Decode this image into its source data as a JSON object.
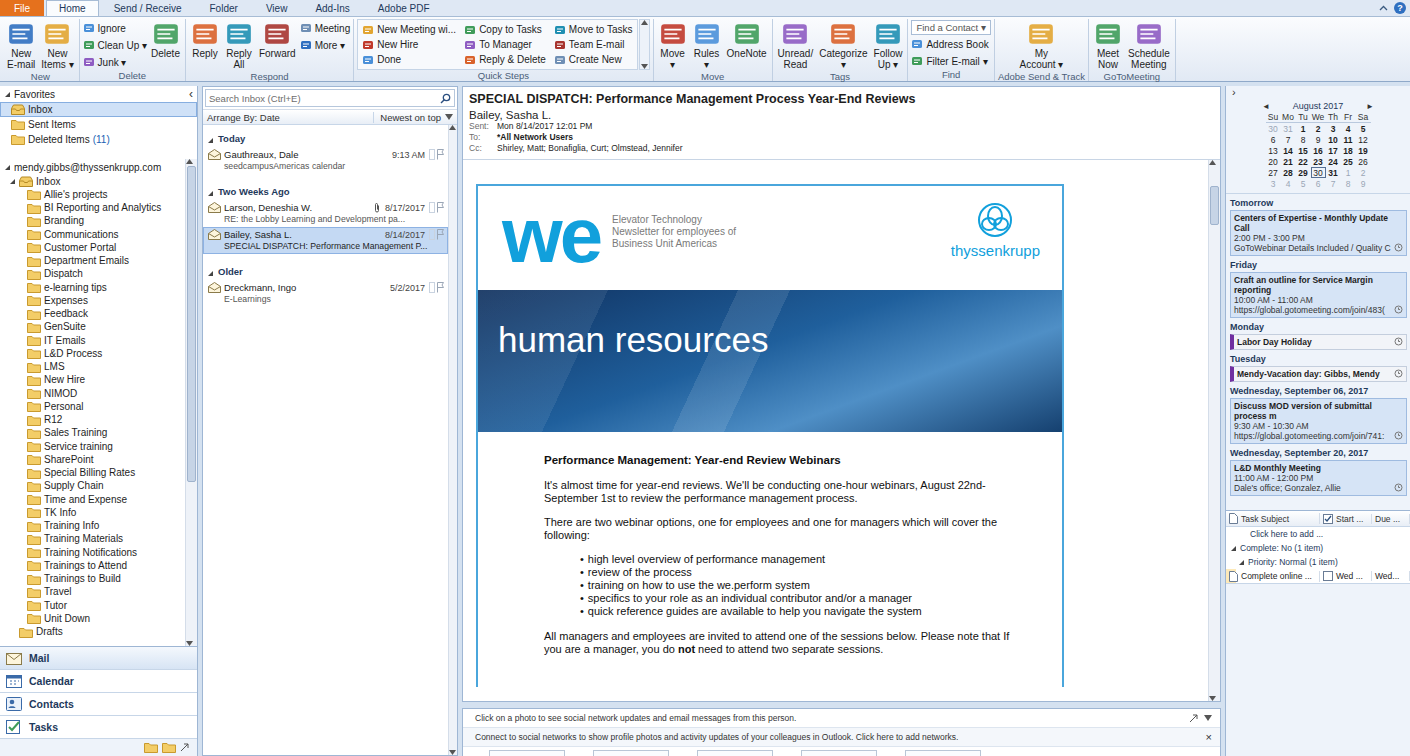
{
  "window": {
    "help": "?"
  },
  "ribbon_tabs": [
    {
      "label": "File",
      "kind": "backstage",
      "selected": false
    },
    {
      "label": "Home",
      "kind": "tab",
      "selected": true
    },
    {
      "label": "Send / Receive",
      "kind": "tab",
      "selected": false
    },
    {
      "label": "Folder",
      "kind": "tab",
      "selected": false
    },
    {
      "label": "View",
      "kind": "tab",
      "selected": false
    },
    {
      "label": "Add-Ins",
      "kind": "tab",
      "selected": false
    },
    {
      "label": "Adobe PDF",
      "kind": "tab",
      "selected": false
    }
  ],
  "ribbon_groups": [
    {
      "label": "New",
      "items": [
        {
          "kind": "large",
          "lines": [
            "New",
            "E-mail"
          ]
        },
        {
          "kind": "large",
          "lines": [
            "New",
            "Items ▾"
          ]
        }
      ]
    },
    {
      "label": "Delete",
      "items": [
        {
          "kind": "stack",
          "entries": [
            "Ignore",
            "Clean Up ▾",
            "Junk ▾"
          ]
        },
        {
          "kind": "large",
          "lines": [
            "Delete"
          ]
        }
      ]
    },
    {
      "label": "Respond",
      "items": [
        {
          "kind": "large",
          "lines": [
            "Reply"
          ]
        },
        {
          "kind": "large",
          "lines": [
            "Reply",
            "All"
          ]
        },
        {
          "kind": "large",
          "lines": [
            "Forward"
          ]
        },
        {
          "kind": "stack",
          "entries": [
            "Meeting",
            "More ▾"
          ]
        }
      ]
    },
    {
      "label": "Quick Steps",
      "items": [
        {
          "kind": "quick",
          "entries": [
            "New Meeting wi...",
            "New Hire",
            "Done",
            "Copy to Tasks",
            "To Manager",
            "Reply & Delete",
            "Move to Tasks",
            "Team E-mail",
            "Create New"
          ]
        }
      ]
    },
    {
      "label": "Move",
      "items": [
        {
          "kind": "large",
          "lines": [
            "Move",
            "▾"
          ]
        },
        {
          "kind": "large",
          "lines": [
            "Rules",
            "▾"
          ]
        },
        {
          "kind": "large",
          "lines": [
            "OneNote"
          ]
        }
      ]
    },
    {
      "label": "Tags",
      "items": [
        {
          "kind": "large",
          "lines": [
            "Unread/",
            "Read"
          ]
        },
        {
          "kind": "large",
          "lines": [
            "Categorize",
            "▾"
          ]
        },
        {
          "kind": "large",
          "lines": [
            "Follow",
            "Up ▾"
          ]
        }
      ]
    },
    {
      "label": "Find",
      "items": [
        {
          "kind": "find",
          "field": "Find a Contact ▾",
          "entries": [
            "Address Book",
            "Filter E-mail ▾"
          ]
        }
      ]
    },
    {
      "label": "Adobe Send & Track",
      "items": [
        {
          "kind": "large",
          "lines": [
            "My",
            "Account ▾"
          ]
        }
      ]
    },
    {
      "label": "GoToMeeting",
      "items": [
        {
          "kind": "large",
          "lines": [
            "Meet",
            "Now"
          ]
        },
        {
          "kind": "large",
          "lines": [
            "Schedule",
            "Meeting"
          ]
        }
      ]
    }
  ],
  "nav": {
    "collapse": "‹",
    "favorites": {
      "label": "Favorites",
      "expanded": true,
      "items": [
        {
          "name": "Inbox",
          "count": "",
          "selected": true
        },
        {
          "name": "Sent Items",
          "count": "",
          "selected": false
        },
        {
          "name": "Deleted Items",
          "count": "(11)",
          "selected": false
        }
      ]
    },
    "account": {
      "label": "mendy.gibbs@thyssenkrupp.com",
      "expanded": true,
      "inbox": {
        "name": "Inbox",
        "expanded": true,
        "selected": false
      },
      "folders": [
        {
          "name": "Allie's projects",
          "selected": false
        },
        {
          "name": "BI Reporting and Analytics",
          "selected": false
        },
        {
          "name": "Branding",
          "selected": false
        },
        {
          "name": "Communications",
          "selected": false
        },
        {
          "name": "Customer Portal",
          "selected": false
        },
        {
          "name": "Department Emails",
          "selected": false
        },
        {
          "name": "Dispatch",
          "selected": false
        },
        {
          "name": "e-learning tips",
          "selected": false
        },
        {
          "name": "Expenses",
          "selected": false
        },
        {
          "name": "Feedback",
          "selected": false
        },
        {
          "name": "GenSuite",
          "selected": false
        },
        {
          "name": "IT Emails",
          "selected": false
        },
        {
          "name": "L&D Process",
          "selected": false
        },
        {
          "name": "LMS",
          "selected": false
        },
        {
          "name": "New Hire",
          "selected": false
        },
        {
          "name": "NIMOD",
          "selected": false
        },
        {
          "name": "Personal",
          "selected": false
        },
        {
          "name": "R12",
          "selected": false
        },
        {
          "name": "Sales Training",
          "selected": false
        },
        {
          "name": "Service training",
          "selected": false
        },
        {
          "name": "SharePoint",
          "selected": false
        },
        {
          "name": "Special Billing Rates",
          "selected": false
        },
        {
          "name": "Supply Chain",
          "selected": false
        },
        {
          "name": "Time and Expense",
          "selected": false
        },
        {
          "name": "TK Info",
          "selected": false
        },
        {
          "name": "Training Info",
          "selected": false
        },
        {
          "name": "Training Materials",
          "selected": false
        },
        {
          "name": "Training Notifications",
          "selected": false
        },
        {
          "name": "Trainings to Attend",
          "selected": false
        },
        {
          "name": "Trainings to Build",
          "selected": false
        },
        {
          "name": "Travel",
          "selected": false
        },
        {
          "name": "Tutor",
          "selected": false
        },
        {
          "name": "Unit Down",
          "selected": false
        }
      ],
      "drafts": {
        "name": "Drafts",
        "selected": false
      }
    },
    "buttons": [
      {
        "label": "Mail",
        "selected": true
      },
      {
        "label": "Calendar",
        "selected": false
      },
      {
        "label": "Contacts",
        "selected": false
      },
      {
        "label": "Tasks",
        "selected": false
      }
    ]
  },
  "mail_list": {
    "search": "Search Inbox (Ctrl+E)",
    "arrange": "Arrange By: Date",
    "order": "Newest on top",
    "groups": [
      {
        "label": "Today",
        "expanded": true,
        "items": [
          {
            "sender": "Gauthreaux, Dale",
            "date": "9:13 AM",
            "subject": "seedcampusAmericas calendar",
            "attachment": false,
            "selected": false
          }
        ]
      },
      {
        "label": "Two Weeks Ago",
        "expanded": true,
        "items": [
          {
            "sender": "Larson, Deneshia W.",
            "date": "8/17/2017",
            "subject": "RE: the Lobby Learning and Development pa...",
            "attachment": true,
            "selected": false
          },
          {
            "sender": "Bailey, Sasha L.",
            "date": "8/14/2017",
            "subject": "SPECIAL DISPATCH: Performance Management P...",
            "attachment": false,
            "selected": true
          }
        ]
      },
      {
        "label": "Older",
        "expanded": true,
        "items": [
          {
            "sender": "Dreckmann, Ingo",
            "date": "5/2/2017",
            "subject": "E-Learnings",
            "attachment": false,
            "selected": false
          }
        ]
      }
    ]
  },
  "message": {
    "subject": "SPECIAL DISPATCH: Performance Management Process Year-End Reviews",
    "from": "Bailey, Sasha L.",
    "meta": [
      {
        "label": "Sent:",
        "value": "Mon 8/14/2017 12:01 PM",
        "bold": false
      },
      {
        "label": "To:",
        "value": "*All Network Users",
        "bold": true
      },
      {
        "label": "Cc:",
        "value": "Shirley, Matt; Bonafiglia, Curt; Olmstead, Jennifer",
        "bold": false
      }
    ],
    "newsletter": {
      "logo": "we",
      "tagline": [
        "Elevator Technology",
        "Newsletter for employees of",
        "Business Unit Americas"
      ],
      "brand": "thyssenkrupp",
      "banner": "human resources",
      "title": "Performance Management: Year-end Review Webinars",
      "paragraphs": [
        "It's almost time for year-end reviews. We'll be conducting one-hour webinars, August 22nd- September 1st to review the performance management process.",
        "There are two webinar options, one for employees and one for managers which will cover the following:"
      ],
      "bullet": "•",
      "bullets": [
        "high level overview of performance management",
        "review of the process",
        "training on how to use the we.perform system",
        "specifics to your role as an individual contributor and/or a manager",
        "quick reference guides are available to help you navigate the system"
      ],
      "closing": [
        {
          "text": "All managers and employees are invited to attend one of the sessions below.  Please note that If you are a manager, you do ",
          "bold": false
        },
        {
          "text": "not",
          "bold": true
        },
        {
          "text": " need to attend two separate sessions.",
          "bold": false
        }
      ]
    }
  },
  "social": {
    "hint": "Click on a photo to see social network updates and email messages from this person.",
    "connect": "Connect to social networks to show profile photos and activity updates of your colleagues in Outlook. Click here to add networks.",
    "close": "×"
  },
  "todo": {
    "toggle": "›",
    "calendar": {
      "month": "August 2017",
      "prev": "◄",
      "next": "►",
      "weekdays": [
        "Su",
        "Mo",
        "Tu",
        "We",
        "Th",
        "Fr",
        "Sa"
      ],
      "weeks": [
        [
          {
            "d": "30",
            "other": true,
            "bold": false,
            "today": false
          },
          {
            "d": "31",
            "other": true,
            "bold": false,
            "today": false
          },
          {
            "d": "1",
            "other": false,
            "bold": true,
            "today": false
          },
          {
            "d": "2",
            "other": false,
            "bold": true,
            "today": false
          },
          {
            "d": "3",
            "other": false,
            "bold": true,
            "today": false
          },
          {
            "d": "4",
            "other": false,
            "bold": true,
            "today": false
          },
          {
            "d": "5",
            "other": false,
            "bold": true,
            "today": false
          }
        ],
        [
          {
            "d": "6",
            "other": false,
            "bold": false,
            "today": false
          },
          {
            "d": "7",
            "other": false,
            "bold": false,
            "today": false
          },
          {
            "d": "8",
            "other": false,
            "bold": false,
            "today": false
          },
          {
            "d": "9",
            "other": false,
            "bold": false,
            "today": false
          },
          {
            "d": "10",
            "other": false,
            "bold": true,
            "today": false
          },
          {
            "d": "11",
            "other": false,
            "bold": true,
            "today": false
          },
          {
            "d": "12",
            "other": false,
            "bold": false,
            "today": false
          }
        ],
        [
          {
            "d": "13",
            "other": false,
            "bold": false,
            "today": false
          },
          {
            "d": "14",
            "other": false,
            "bold": true,
            "today": false
          },
          {
            "d": "15",
            "other": false,
            "bold": true,
            "today": false
          },
          {
            "d": "16",
            "other": false,
            "bold": true,
            "today": false
          },
          {
            "d": "17",
            "other": false,
            "bold": true,
            "today": false
          },
          {
            "d": "18",
            "other": false,
            "bold": true,
            "today": false
          },
          {
            "d": "19",
            "other": false,
            "bold": true,
            "today": false
          }
        ],
        [
          {
            "d": "20",
            "other": false,
            "bold": false,
            "today": false
          },
          {
            "d": "21",
            "other": false,
            "bold": true,
            "today": false
          },
          {
            "d": "22",
            "other": false,
            "bold": true,
            "today": false
          },
          {
            "d": "23",
            "other": false,
            "bold": true,
            "today": false
          },
          {
            "d": "24",
            "other": false,
            "bold": true,
            "today": false
          },
          {
            "d": "25",
            "other": false,
            "bold": true,
            "today": false
          },
          {
            "d": "26",
            "other": false,
            "bold": false,
            "today": false
          }
        ],
        [
          {
            "d": "27",
            "other": false,
            "bold": false,
            "today": false
          },
          {
            "d": "28",
            "other": false,
            "bold": true,
            "today": false
          },
          {
            "d": "29",
            "other": false,
            "bold": true,
            "today": false
          },
          {
            "d": "30",
            "other": false,
            "bold": false,
            "today": true
          },
          {
            "d": "31",
            "other": false,
            "bold": true,
            "today": false
          },
          {
            "d": "1",
            "other": true,
            "bold": false,
            "today": false
          },
          {
            "d": "2",
            "other": true,
            "bold": false,
            "today": false
          }
        ],
        [
          {
            "d": "3",
            "other": true,
            "bold": false,
            "today": false
          },
          {
            "d": "4",
            "other": true,
            "bold": false,
            "today": false
          },
          {
            "d": "5",
            "other": true,
            "bold": false,
            "today": false
          },
          {
            "d": "6",
            "other": true,
            "bold": false,
            "today": false
          },
          {
            "d": "7",
            "other": true,
            "bold": false,
            "today": false
          },
          {
            "d": "8",
            "other": true,
            "bold": false,
            "today": false
          },
          {
            "d": "9",
            "other": true,
            "bold": false,
            "today": false
          }
        ]
      ]
    },
    "agenda": [
      {
        "day": "Tomorrow",
        "items": [
          {
            "kind": "meeting",
            "title": "Centers of Expertise - Monthly Update Call",
            "time": "2:00 PM - 3:00 PM",
            "location": "GoToWebinar Details Included / Quality C"
          }
        ]
      },
      {
        "day": "Friday",
        "items": [
          {
            "kind": "meeting",
            "title": "Craft an outline for Service Margin reporting",
            "time": "10:00 AM - 11:00 AM",
            "location": "https://global.gotomeeting.com/join/483("
          }
        ]
      },
      {
        "day": "Monday",
        "items": [
          {
            "kind": "allday",
            "title": "Labor Day Holiday",
            "time": "",
            "location": ""
          }
        ]
      },
      {
        "day": "Tuesday",
        "items": [
          {
            "kind": "allday",
            "title": "Mendy-Vacation day: Gibbs, Mendy",
            "time": "",
            "location": ""
          }
        ]
      },
      {
        "day": "Wednesday, September 06, 2017",
        "items": [
          {
            "kind": "meeting",
            "title": "Discuss MOD version of submittal process m",
            "time": "9:30 AM - 10:30 AM",
            "location": "https://global.gotomeeting.com/join/741:"
          }
        ]
      },
      {
        "day": "Wednesday, September 20, 2017",
        "items": [
          {
            "kind": "meeting",
            "title": "L&D Monthly Meeting",
            "time": "11:00 AM - 12:00 PM",
            "location": "Dale's office; Gonzalez, Allie"
          }
        ]
      }
    ],
    "tasks": {
      "columns": [
        "Task Subject",
        "Start ...",
        "Due ..."
      ],
      "add": "Click here to add ...",
      "group": "Complete: No (1 item)",
      "subgroup": "Priority: Normal (1 item)",
      "items": [
        {
          "subject": "Complete online ...",
          "start": "Wed ...",
          "due": "Wed...",
          "complete": false
        }
      ]
    }
  }
}
